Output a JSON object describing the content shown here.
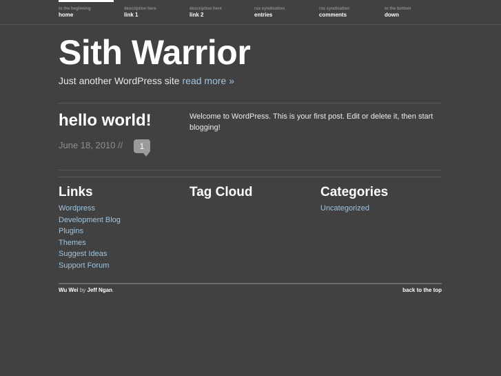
{
  "nav": {
    "items": [
      {
        "desc": "to the beginning",
        "label": "home"
      },
      {
        "desc": "description here",
        "label": "link 1"
      },
      {
        "desc": "description here",
        "label": "link 2"
      },
      {
        "desc": "rss syndication",
        "label": "entries"
      },
      {
        "desc": "rss syndication",
        "label": "comments"
      },
      {
        "desc": "to the bottom",
        "label": "down"
      }
    ]
  },
  "header": {
    "title": "Sith Warrior",
    "tagline": "Just another WordPress site",
    "read_more": "read more »"
  },
  "post": {
    "title": "hello world!",
    "date": "June 18, 2010 //",
    "comment_count": "1",
    "body": "Welcome to WordPress. This is your first post. Edit or delete it, then start blogging!"
  },
  "widgets": {
    "links": {
      "title": "Links",
      "items": [
        "Wordpress",
        "Development Blog",
        "Plugins",
        "Themes",
        "Suggest Ideas",
        "Support Forum"
      ]
    },
    "tag_cloud": {
      "title": "Tag Cloud"
    },
    "categories": {
      "title": "Categories",
      "items": [
        "Uncategorized"
      ]
    }
  },
  "footer": {
    "theme": "Wu Wei",
    "by": "by",
    "author": "Jeff Ngan",
    "period": ".",
    "back_to_top": "back to the top"
  },
  "colors": {
    "background": "#414141",
    "link": "#9fc4de",
    "muted": "#8e8e8e"
  }
}
